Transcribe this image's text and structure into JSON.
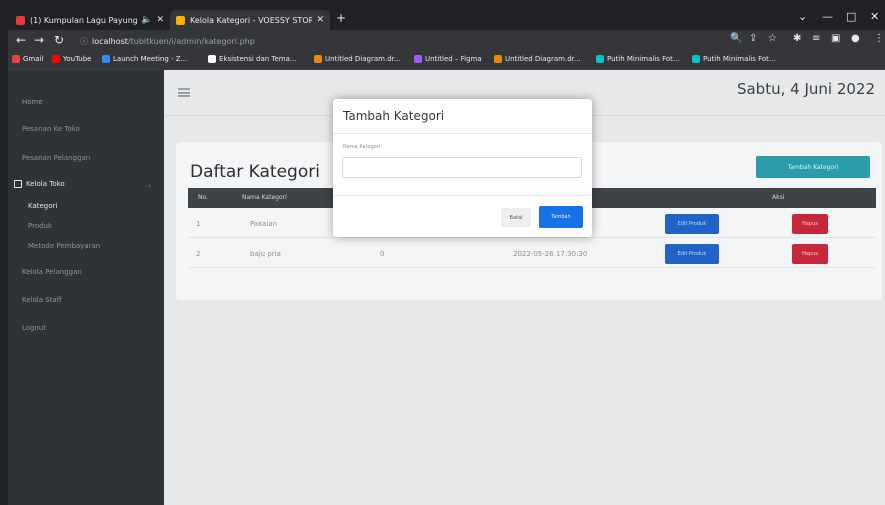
{
  "browser": {
    "tabs": [
      {
        "label": "(1) Kumpulan Lagu Payung Teduh",
        "active": false,
        "favicon_color": "#e53935"
      },
      {
        "label": "Kelola Kategori - VOESSY STORE",
        "active": true,
        "favicon_color": "#f4b400"
      }
    ],
    "new_tab": "+",
    "window_controls": {
      "minimize": "—",
      "maximize": "□",
      "close": "✕",
      "dropdown": "⌄"
    },
    "address": {
      "host": "localhost",
      "path": "/tubitkuen/i/admin/kategori.php"
    },
    "bookmarks": [
      {
        "label": "Gmail",
        "color": "#ea4335"
      },
      {
        "label": "YouTube",
        "color": "#ff0000"
      },
      {
        "label": "Launch Meeting - Z...",
        "color": "#2d8cff"
      },
      {
        "label": "Eksistensi dan Tema...",
        "color": "#ffffff"
      },
      {
        "label": "Untitled Diagram.dr...",
        "color": "#f08705"
      },
      {
        "label": "Untitled – Figma",
        "color": "#a259ff"
      },
      {
        "label": "Untitled Diagram.dr...",
        "color": "#f08705"
      },
      {
        "label": "Putih Minimalis Fot...",
        "color": "#00c4cc"
      },
      {
        "label": "Putih Minimalis Fot...",
        "color": "#00c4cc"
      }
    ]
  },
  "sidebar": {
    "items": [
      {
        "label": "Home"
      },
      {
        "label": "Pesanan Ke Toko"
      },
      {
        "label": "Pesanan Pelanggan"
      },
      {
        "label": "Kelola Toko"
      },
      {
        "label": "Kategori"
      },
      {
        "label": "Produk"
      },
      {
        "label": "Metode Pembayaran"
      },
      {
        "label": "Kelola Pelanggan"
      },
      {
        "label": "Kelola Staff"
      },
      {
        "label": "Logout"
      }
    ],
    "caret": "‹"
  },
  "header": {
    "date": "Sabtu, 4 Juni 2022"
  },
  "main": {
    "title": "Daftar Kategori",
    "add_button": "Tambah Kategori",
    "columns": [
      "No.",
      "Nama Kategori",
      "Aksi"
    ],
    "rows": [
      {
        "no": "1",
        "name": "Pakaian",
        "count": "",
        "date": "",
        "edit": "Edit Produk",
        "delete": "Hapus"
      },
      {
        "no": "2",
        "name": "baju pria",
        "count": "0",
        "date": "2022-05-26 17:30:30",
        "edit": "Edit Produk",
        "delete": "Hapus"
      }
    ]
  },
  "modal": {
    "title": "Tambah Kategori",
    "field_label": "Nama Kategori",
    "field_value": "",
    "close_label": "Batal",
    "submit_label": "Tambah"
  },
  "colors": {
    "sidebar_bg": "#2f3236",
    "add_button": "#2b9cab",
    "edit_button": "#1f63c7",
    "delete_button": "#c8263b",
    "submit_button": "#1572e8"
  }
}
